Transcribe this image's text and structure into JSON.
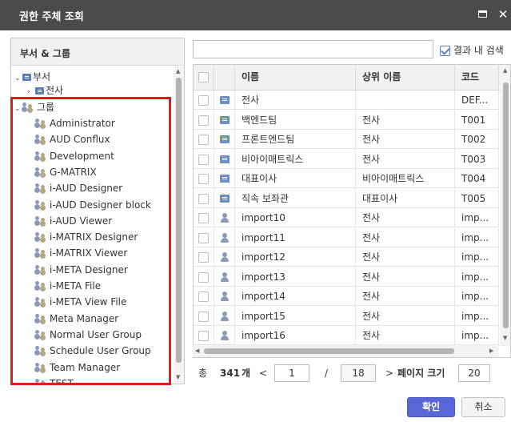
{
  "window": {
    "title": "권한 주체 조회"
  },
  "left_panel": {
    "header": "부서 & 그룹",
    "tree": {
      "dept_root": "부서",
      "dept_child": "전사",
      "group_root": "그룹",
      "groups": [
        "Administrator",
        "AUD Conflux",
        "Development",
        "G-MATRIX",
        "i-AUD Designer",
        "i-AUD Designer block",
        "i-AUD Viewer",
        "i-MATRIX Designer",
        "i-MATRIX Viewer",
        "i-META Designer",
        "i-META File",
        "i-META View File",
        "Meta Manager",
        "Normal User Group",
        "Schedule User Group",
        "Team Manager",
        "TEST"
      ]
    }
  },
  "search": {
    "value": "",
    "placeholder": "",
    "in_result_label": "결과 내 검색",
    "in_result_checked": true
  },
  "grid": {
    "columns": [
      "",
      "",
      "이름",
      "상위 이름",
      "코드"
    ],
    "rows": [
      {
        "type": "dept",
        "name": "전사",
        "parent": "",
        "code": "DEF..."
      },
      {
        "type": "dept",
        "name": "백엔드팀",
        "parent": "전사",
        "code": "T001"
      },
      {
        "type": "dept",
        "name": "프론트엔드팀",
        "parent": "전사",
        "code": "T002"
      },
      {
        "type": "dept",
        "name": "비아이매트릭스",
        "parent": "전사",
        "code": "T003"
      },
      {
        "type": "dept",
        "name": "대표이사",
        "parent": "비아이매트릭스",
        "code": "T004"
      },
      {
        "type": "dept",
        "name": "직속 보좌관",
        "parent": "대표이사",
        "code": "T005"
      },
      {
        "type": "user",
        "name": "import10",
        "parent": "전사",
        "code": "imp..."
      },
      {
        "type": "user",
        "name": "import11",
        "parent": "전사",
        "code": "imp..."
      },
      {
        "type": "user",
        "name": "import12",
        "parent": "전사",
        "code": "imp..."
      },
      {
        "type": "user",
        "name": "import13",
        "parent": "전사",
        "code": "imp..."
      },
      {
        "type": "user",
        "name": "import14",
        "parent": "전사",
        "code": "imp..."
      },
      {
        "type": "user",
        "name": "import15",
        "parent": "전사",
        "code": "imp..."
      },
      {
        "type": "user",
        "name": "import16",
        "parent": "전사",
        "code": "imp..."
      }
    ]
  },
  "pager": {
    "total_label": "총",
    "total": "341",
    "unit": "개",
    "prev": "<",
    "page": "1",
    "sep": "/",
    "total_pages": "18",
    "next": ">",
    "page_size_label": "페이지 크기",
    "page_size": "20"
  },
  "buttons": {
    "ok": "확인",
    "cancel": "취소"
  }
}
